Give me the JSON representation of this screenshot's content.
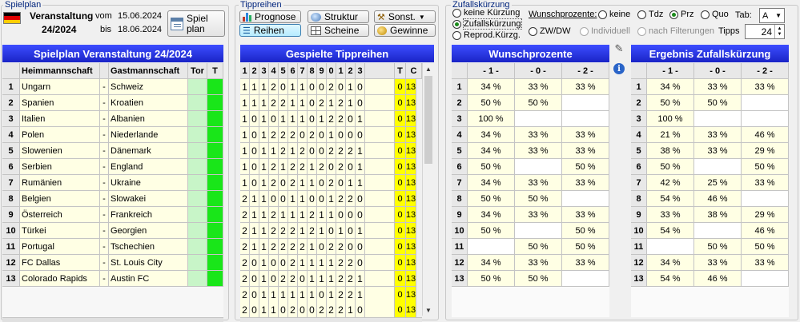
{
  "spielplan": {
    "group_title": "Spielplan",
    "event_label": "Veranstaltung",
    "event_number": "24/2024",
    "from_label": "vom",
    "from_date": "15.06.2024",
    "to_label": "bis",
    "to_date": "18.06.2024",
    "button_line1": "Spiel",
    "button_line2": "plan",
    "grid_title": "Spielplan Veranstaltung 24/2024",
    "col_home": "Heimmannschaft",
    "col_away": "Gastmannschaft",
    "col_goals": "Tor",
    "col_t": "T",
    "matches": [
      {
        "n": "1",
        "home": "Ungarn",
        "away": "Schweiz"
      },
      {
        "n": "2",
        "home": "Spanien",
        "away": "Kroatien"
      },
      {
        "n": "3",
        "home": "Italien",
        "away": "Albanien"
      },
      {
        "n": "4",
        "home": "Polen",
        "away": "Niederlande"
      },
      {
        "n": "5",
        "home": "Slowenien",
        "away": "Dänemark"
      },
      {
        "n": "6",
        "home": "Serbien",
        "away": "England"
      },
      {
        "n": "7",
        "home": "Rumänien",
        "away": "Ukraine"
      },
      {
        "n": "8",
        "home": "Belgien",
        "away": "Slowakei"
      },
      {
        "n": "9",
        "home": "Österreich",
        "away": "Frankreich"
      },
      {
        "n": "10",
        "home": "Türkei",
        "away": "Georgien"
      },
      {
        "n": "11",
        "home": "Portugal",
        "away": "Tschechien"
      },
      {
        "n": "12",
        "home": "FC Dallas",
        "away": "St. Louis City"
      },
      {
        "n": "13",
        "home": "Colorado Rapids",
        "away": "Austin FC"
      }
    ]
  },
  "tippreihen": {
    "group_title": "Tippreihen",
    "btn_prognose": "Prognose",
    "btn_reihen": "Reihen",
    "btn_struktur": "Struktur",
    "btn_scheine": "Scheine",
    "btn_sonst": "Sonst.",
    "btn_gewinne": "Gewinne",
    "grid_title": "Gespielte Tippreihen",
    "col_headers": [
      "1",
      "2",
      "3",
      "4",
      "5",
      "6",
      "7",
      "8",
      "9",
      "0",
      "1",
      "2",
      "3"
    ],
    "col_t": "T",
    "col_c": "C",
    "rows": [
      "1112011002010",
      "1112211021210",
      "1010111012201",
      "1012220201000",
      "1011212002221",
      "1012122120201",
      "1012021102011",
      "2110011001220",
      "2112111211000",
      "2112221210101",
      "2112222102200",
      "2010021111220",
      "2010220111221",
      "2011111101221",
      "2011020022210"
    ],
    "t_value": "0",
    "c_value": "13"
  },
  "zufall": {
    "group_title": "Zufallskürzung",
    "opt_keine": "keine Kürzung",
    "opt_zufall": "Zufallskürzung",
    "opt_reprod": "Reprod.Kürzg.",
    "wunsch_label": "Wunschprozente:",
    "opt_w_keine": "keine",
    "opt_tdz": "Tdz",
    "opt_prz": "Prz",
    "opt_quo": "Quo",
    "tab_label": "Tab:",
    "tab_value": "A",
    "opt_zwdw": "ZW/DW",
    "opt_individuell": "Individuell",
    "opt_nach": "nach Filterungen",
    "tipps_label": "Tipps",
    "tipps_value": "24",
    "wunsch_title": "Wunschprozente",
    "ergebnis_title": "Ergebnis Zufallskürzung",
    "pct_headers": [
      "- 1 -",
      "- 0 -",
      "- 2 -"
    ],
    "wunsch_rows": [
      [
        "34 %",
        "33 %",
        "33 %"
      ],
      [
        "50 %",
        "50 %",
        ""
      ],
      [
        "100 %",
        "",
        ""
      ],
      [
        "34 %",
        "33 %",
        "33 %"
      ],
      [
        "34 %",
        "33 %",
        "33 %"
      ],
      [
        "50 %",
        "",
        "50 %"
      ],
      [
        "34 %",
        "33 %",
        "33 %"
      ],
      [
        "50 %",
        "50 %",
        ""
      ],
      [
        "34 %",
        "33 %",
        "33 %"
      ],
      [
        "50 %",
        "",
        "50 %"
      ],
      [
        "",
        "50 %",
        "50 %"
      ],
      [
        "34 %",
        "33 %",
        "33 %"
      ],
      [
        "50 %",
        "50 %",
        ""
      ]
    ],
    "ergebnis_rows": [
      [
        "34 %",
        "33 %",
        "33 %"
      ],
      [
        "50 %",
        "50 %",
        ""
      ],
      [
        "100 %",
        "",
        ""
      ],
      [
        "21 %",
        "33 %",
        "46 %"
      ],
      [
        "38 %",
        "33 %",
        "29 %"
      ],
      [
        "50 %",
        "",
        "50 %"
      ],
      [
        "42 %",
        "25 %",
        "33 %"
      ],
      [
        "54 %",
        "46 %",
        ""
      ],
      [
        "33 %",
        "38 %",
        "29 %"
      ],
      [
        "54 %",
        "",
        "46 %"
      ],
      [
        "",
        "50 %",
        "50 %"
      ],
      [
        "34 %",
        "33 %",
        "33 %"
      ],
      [
        "54 %",
        "46 %",
        ""
      ]
    ]
  },
  "colors": {
    "title_blue": "#2030e0",
    "goal_green": "#19e619",
    "tip_yellow": "#ffff00"
  }
}
